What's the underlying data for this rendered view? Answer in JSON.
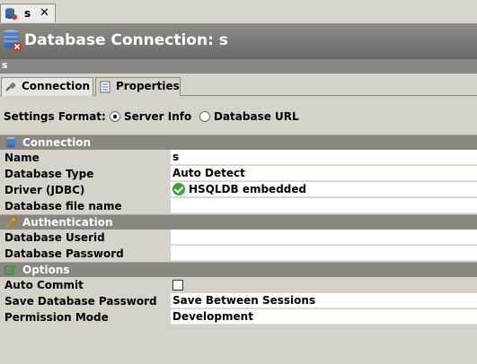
{
  "editor_tab": {
    "label": "s",
    "close": "✕"
  },
  "header": {
    "title": "Database Connection: s",
    "subtitle": "s"
  },
  "tabs": [
    {
      "label": "Connection",
      "active": true,
      "icon": "plug-icon"
    },
    {
      "label": "Properties",
      "active": false,
      "icon": "properties-icon"
    }
  ],
  "settings_format": {
    "label": "Settings Format:",
    "options": [
      {
        "label": "Server Info",
        "selected": true
      },
      {
        "label": "Database URL",
        "selected": false
      }
    ]
  },
  "sections": {
    "connection": {
      "title": "Connection",
      "icon": "database-icon"
    },
    "authentication": {
      "title": "Authentication",
      "icon": "key-icon"
    },
    "options": {
      "title": "Options",
      "icon": "checkmark-icon"
    }
  },
  "fields": {
    "name": {
      "label": "Name",
      "value": "s"
    },
    "database_type": {
      "label": "Database Type",
      "value": "Auto Detect"
    },
    "driver": {
      "label": "Driver (JDBC)",
      "value": "HSQLDB embedded"
    },
    "database_file_name": {
      "label": "Database file name",
      "value": ""
    },
    "database_userid": {
      "label": "Database Userid",
      "value": ""
    },
    "database_password": {
      "label": "Database Password",
      "value": ""
    },
    "auto_commit": {
      "label": "Auto Commit",
      "checked": false
    },
    "save_password": {
      "label": "Save Database Password",
      "value": "Save Between Sessions"
    },
    "permission_mode": {
      "label": "Permission Mode",
      "value": "Development"
    }
  },
  "colors": {
    "header_bg": "#7d7a75",
    "section_bg": "#8a8781",
    "panel_bg": "#d6d2c9",
    "ok_green": "#3aa33a"
  }
}
